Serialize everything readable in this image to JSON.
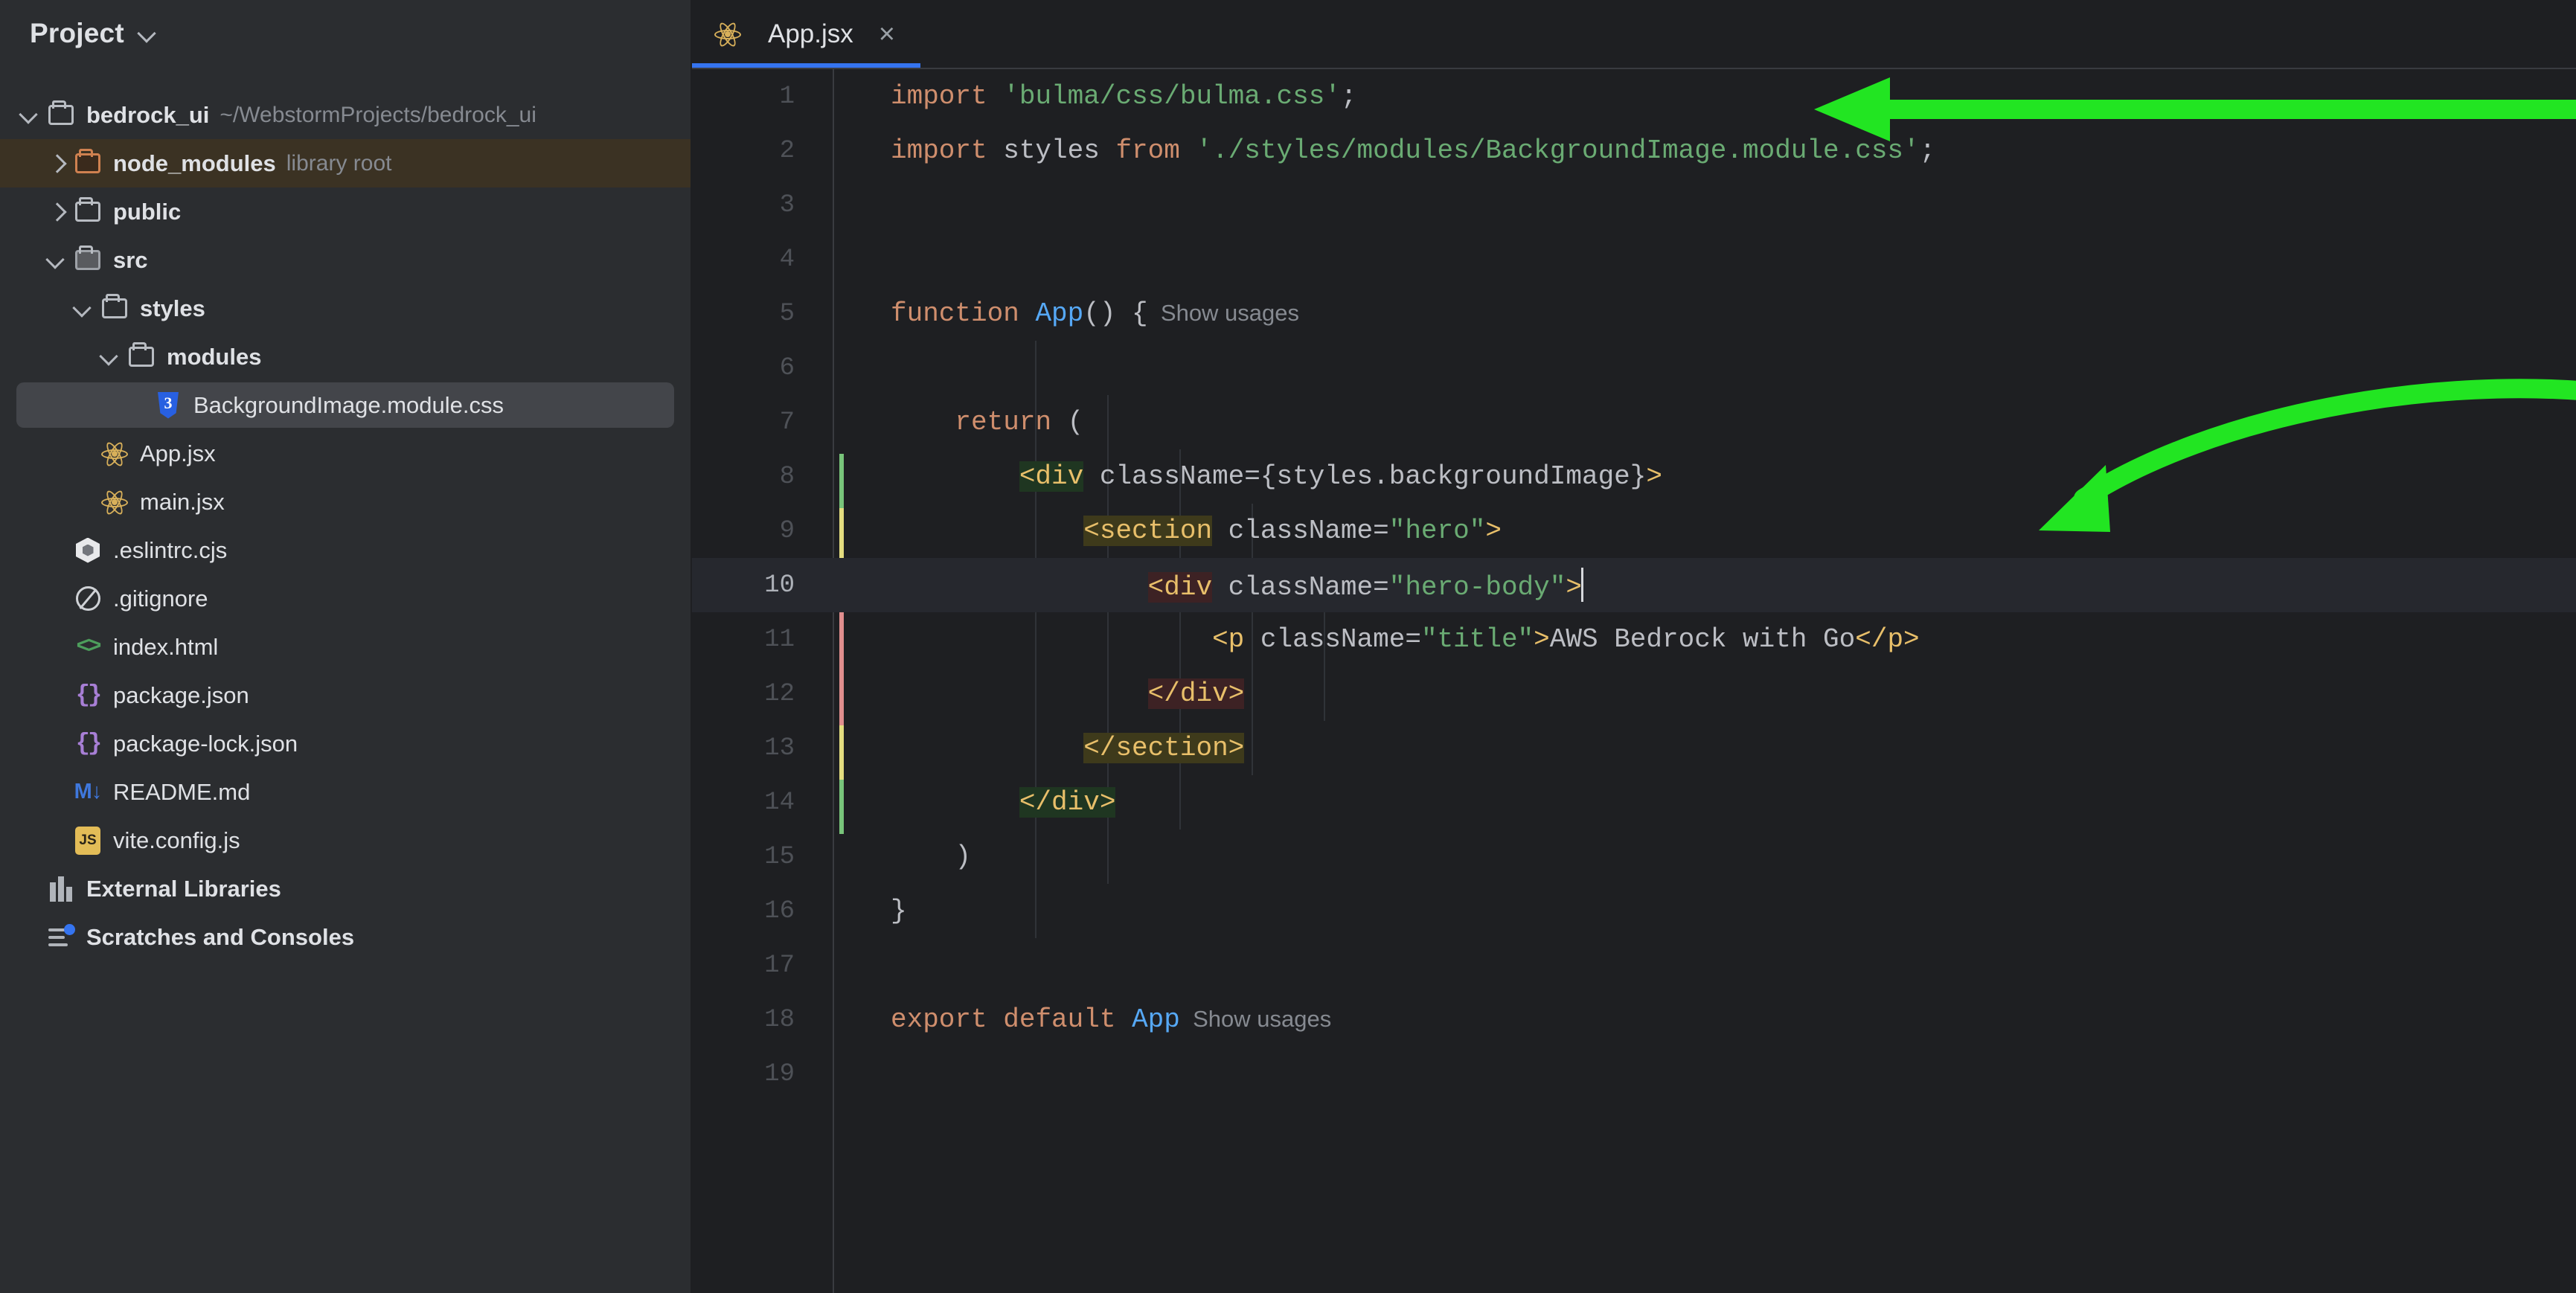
{
  "sidebar": {
    "header": {
      "title": "Project",
      "chevron_icon": "chevron-down-icon"
    },
    "tree": [
      {
        "indent": 0,
        "arrow": "open",
        "icon": "folder-icon",
        "label": "bedrock_ui",
        "secondary": "~/WebstormProjects/bedrock_ui",
        "state": "normal"
      },
      {
        "indent": 1,
        "arrow": "closed",
        "icon": "folder-orange-icon",
        "label": "node_modules",
        "secondary": "library root",
        "state": "highlight"
      },
      {
        "indent": 1,
        "arrow": "closed",
        "icon": "folder-icon",
        "label": "public",
        "secondary": "",
        "state": "normal"
      },
      {
        "indent": 1,
        "arrow": "open",
        "icon": "folder-filled-icon",
        "label": "src",
        "secondary": "",
        "state": "normal"
      },
      {
        "indent": 2,
        "arrow": "open",
        "icon": "folder-icon",
        "label": "styles",
        "secondary": "",
        "state": "normal"
      },
      {
        "indent": 3,
        "arrow": "open",
        "icon": "folder-icon",
        "label": "modules",
        "secondary": "",
        "state": "normal"
      },
      {
        "indent": 4,
        "arrow": "none",
        "icon": "css3-file-icon",
        "label": "BackgroundImage.module.css",
        "secondary": "",
        "state": "selected"
      },
      {
        "indent": 2,
        "arrow": "none",
        "icon": "react-file-icon",
        "label": "App.jsx",
        "secondary": "",
        "state": "normal"
      },
      {
        "indent": 2,
        "arrow": "none",
        "icon": "react-file-icon",
        "label": "main.jsx",
        "secondary": "",
        "state": "normal"
      },
      {
        "indent": 1,
        "arrow": "none",
        "icon": "eslint-file-icon",
        "label": ".eslintrc.cjs",
        "secondary": "",
        "state": "normal"
      },
      {
        "indent": 1,
        "arrow": "none",
        "icon": "gitignore-file-icon",
        "label": ".gitignore",
        "secondary": "",
        "state": "normal"
      },
      {
        "indent": 1,
        "arrow": "none",
        "icon": "html-file-icon",
        "label": "index.html",
        "secondary": "",
        "state": "normal"
      },
      {
        "indent": 1,
        "arrow": "none",
        "icon": "json-file-icon",
        "label": "package.json",
        "secondary": "",
        "state": "normal"
      },
      {
        "indent": 1,
        "arrow": "none",
        "icon": "json-file-icon",
        "label": "package-lock.json",
        "secondary": "",
        "state": "normal"
      },
      {
        "indent": 1,
        "arrow": "none",
        "icon": "markdown-file-icon",
        "label": "README.md",
        "secondary": "",
        "state": "normal"
      },
      {
        "indent": 1,
        "arrow": "none",
        "icon": "js-file-icon",
        "label": "vite.config.js",
        "secondary": "",
        "state": "normal"
      },
      {
        "indent": 0,
        "arrow": "none",
        "icon": "external-libraries-icon",
        "label": "External Libraries",
        "secondary": "",
        "state": "normal"
      },
      {
        "indent": 0,
        "arrow": "none",
        "icon": "scratches-icon",
        "label": "Scratches and Consoles",
        "secondary": "",
        "state": "normal"
      }
    ]
  },
  "editor": {
    "tab": {
      "icon": "react-file-icon",
      "label": "App.jsx",
      "close_label": "×"
    },
    "current_line": 10,
    "lines": [
      {
        "n": "1",
        "tokens": [
          {
            "t": "import",
            "c": "kw"
          },
          {
            "t": " ",
            "c": "pln"
          },
          {
            "t": "'bulma/css/bulma.css'",
            "c": "str"
          },
          {
            "t": ";",
            "c": "pln"
          }
        ]
      },
      {
        "n": "2",
        "tokens": [
          {
            "t": "import",
            "c": "kw"
          },
          {
            "t": " styles ",
            "c": "pln"
          },
          {
            "t": "from",
            "c": "kw"
          },
          {
            "t": " ",
            "c": "pln"
          },
          {
            "t": "'./styles/modules/BackgroundImage.module.css'",
            "c": "str"
          },
          {
            "t": ";",
            "c": "pln"
          }
        ]
      },
      {
        "n": "3",
        "tokens": []
      },
      {
        "n": "4",
        "tokens": []
      },
      {
        "n": "5",
        "tokens": [
          {
            "t": "function",
            "c": "kw"
          },
          {
            "t": " ",
            "c": "pln"
          },
          {
            "t": "App",
            "c": "def"
          },
          {
            "t": "() {",
            "c": "pln"
          },
          {
            "t": "  Show usages",
            "c": "hint"
          }
        ]
      },
      {
        "n": "6",
        "tokens": []
      },
      {
        "n": "7",
        "tokens": [
          {
            "t": "    ",
            "c": "pln"
          },
          {
            "t": "return",
            "c": "kw"
          },
          {
            "t": " (",
            "c": "pln"
          }
        ]
      },
      {
        "n": "8",
        "tokens": [
          {
            "t": "        ",
            "c": "pln"
          },
          {
            "t": "<div",
            "c": "tag hl-green"
          },
          {
            "t": " className=",
            "c": "attr"
          },
          {
            "t": "{styles.backgroundImage}",
            "c": "pln"
          },
          {
            "t": ">",
            "c": "tag"
          }
        ]
      },
      {
        "n": "9",
        "tokens": [
          {
            "t": "            ",
            "c": "pln"
          },
          {
            "t": "<section",
            "c": "tag hl-olive"
          },
          {
            "t": " className=",
            "c": "attr"
          },
          {
            "t": "\"hero\"",
            "c": "str"
          },
          {
            "t": ">",
            "c": "tag"
          }
        ]
      },
      {
        "n": "10",
        "tokens": [
          {
            "t": "                ",
            "c": "pln"
          },
          {
            "t": "<div",
            "c": "tag hl-red"
          },
          {
            "t": " className=",
            "c": "attr"
          },
          {
            "t": "\"hero-body\"",
            "c": "str"
          },
          {
            "t": ">",
            "c": "tag"
          }
        ]
      },
      {
        "n": "11",
        "tokens": [
          {
            "t": "                    ",
            "c": "pln"
          },
          {
            "t": "<p",
            "c": "tag"
          },
          {
            "t": " className=",
            "c": "attr"
          },
          {
            "t": "\"title\"",
            "c": "str"
          },
          {
            "t": ">",
            "c": "tag"
          },
          {
            "t": "AWS Bedrock with Go",
            "c": "attr"
          },
          {
            "t": "</p>",
            "c": "tag"
          }
        ]
      },
      {
        "n": "12",
        "tokens": [
          {
            "t": "                ",
            "c": "pln"
          },
          {
            "t": "</div>",
            "c": "tag hl-red"
          }
        ]
      },
      {
        "n": "13",
        "tokens": [
          {
            "t": "            ",
            "c": "pln"
          },
          {
            "t": "</section>",
            "c": "tag hl-olive"
          }
        ]
      },
      {
        "n": "14",
        "tokens": [
          {
            "t": "        ",
            "c": "pln"
          },
          {
            "t": "</div>",
            "c": "tag hl-green"
          }
        ]
      },
      {
        "n": "15",
        "tokens": [
          {
            "t": "    )",
            "c": "pln"
          }
        ]
      },
      {
        "n": "16",
        "tokens": [
          {
            "t": "}",
            "c": "pln"
          }
        ]
      },
      {
        "n": "17",
        "tokens": []
      },
      {
        "n": "18",
        "tokens": [
          {
            "t": "export",
            "c": "kw"
          },
          {
            "t": " ",
            "c": "pln"
          },
          {
            "t": "default",
            "c": "kw"
          },
          {
            "t": " ",
            "c": "pln"
          },
          {
            "t": "App",
            "c": "def"
          },
          {
            "t": "  Show usages",
            "c": "hint"
          }
        ]
      },
      {
        "n": "19",
        "tokens": []
      }
    ],
    "gutter_bulb_icon": "lightbulb-icon",
    "structure_bar_colors": [
      "#78c47a",
      "#e4dd7f",
      "#e08e8e",
      "#e4dd7f",
      "#78c47a"
    ]
  },
  "annotations": {
    "arrow_straight": {
      "icon": "arrow-left-annotation",
      "color": "#22e522"
    },
    "arrow_curved": {
      "icon": "curved-arrow-annotation",
      "color": "#22e522"
    }
  },
  "colors": {
    "sidebar_bg": "#2b2d30",
    "editor_bg": "#1e1f22",
    "accent": "#3574f0",
    "highlight_row": "#3b3223",
    "selected_row": "#43454a",
    "current_line": "#26282e"
  }
}
